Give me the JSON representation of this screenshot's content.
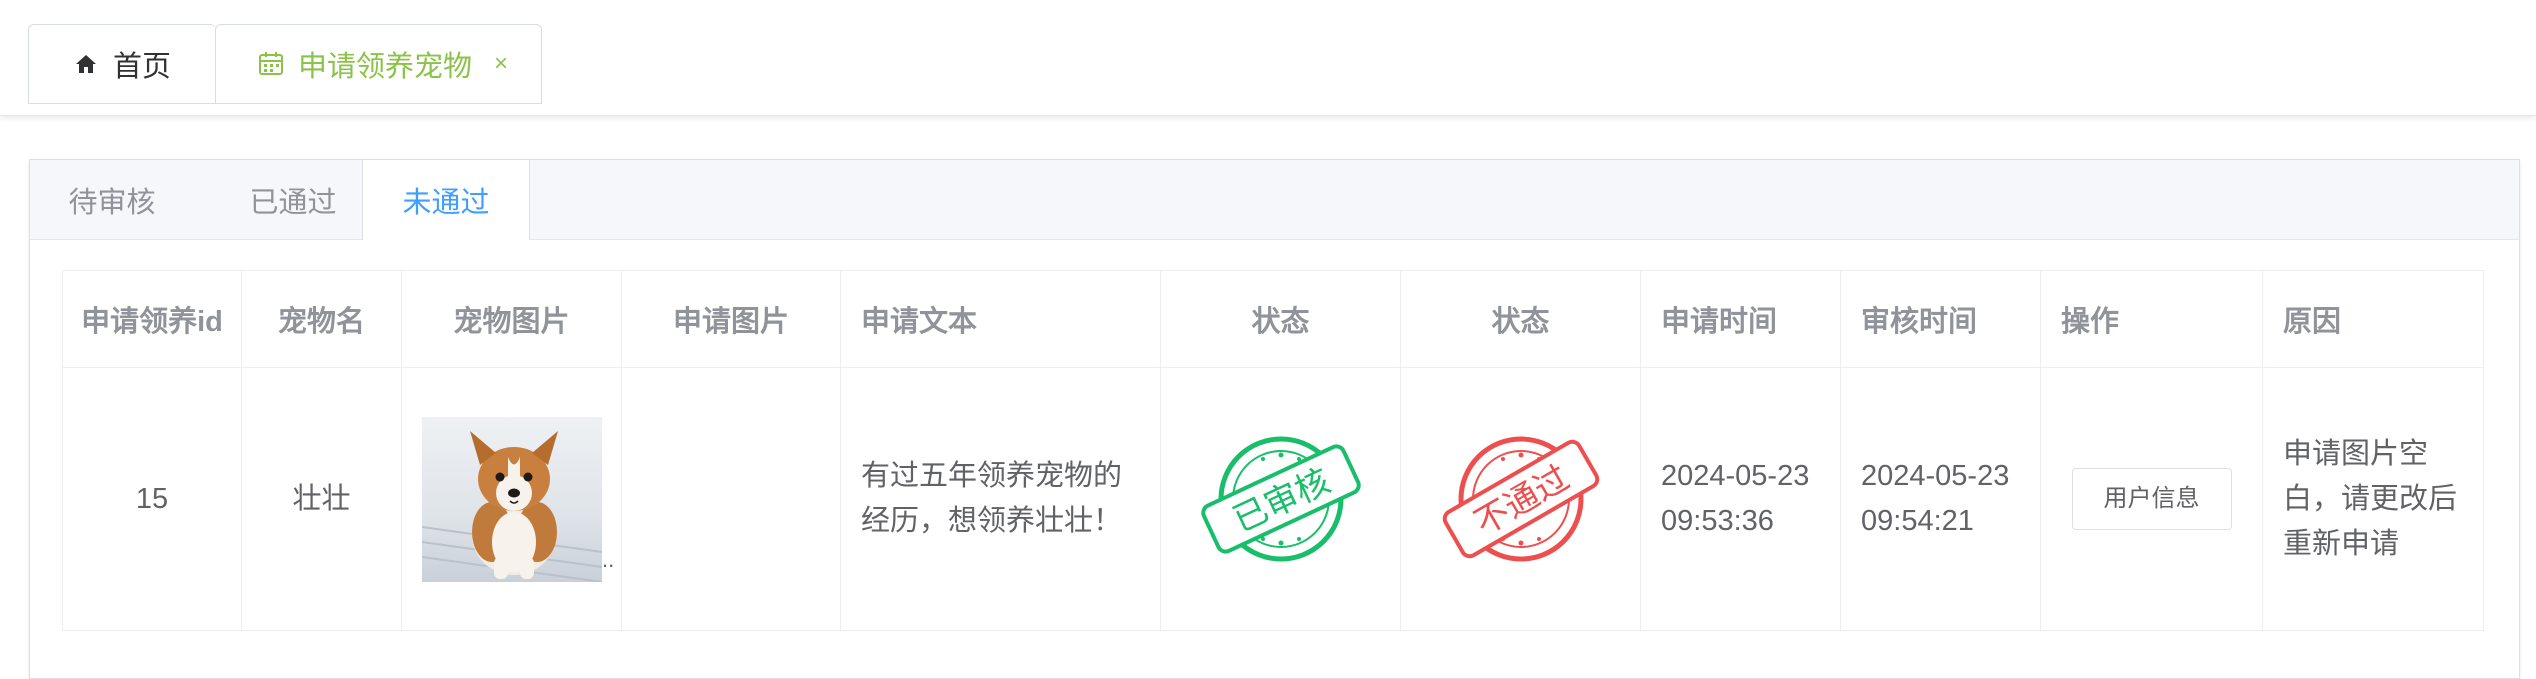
{
  "tags": {
    "home": {
      "label": "首页",
      "icon": "home-icon"
    },
    "active": {
      "label": "申请领养宠物",
      "icon": "calendar-icon",
      "close": "×"
    }
  },
  "tabs": [
    {
      "label": "待审核",
      "active": false
    },
    {
      "label": "已通过",
      "active": false
    },
    {
      "label": "未通过",
      "active": true
    }
  ],
  "table": {
    "headers": [
      "申请领养id",
      "宠物名",
      "宠物图片",
      "申请图片",
      "申请文本",
      "状态",
      "状态",
      "申请时间",
      "审核时间",
      "操作",
      "原因"
    ],
    "rows": [
      {
        "id": "15",
        "pet_name": "壮壮",
        "pet_image": "puppy-photo",
        "pet_image_ellipsis": "..",
        "apply_image": "",
        "apply_text": "有过五年领养宠物的经历，想领养壮壮！",
        "status1_stamp": "已审核",
        "status2_stamp": "不通过",
        "apply_time": "2024-05-23 09:53:36",
        "review_time": "2024-05-23 09:54:21",
        "action_label": "用户信息",
        "reason": "申请图片空白，请更改后重新申请"
      }
    ]
  },
  "colors": {
    "accent_green": "#8bc34a",
    "tab_active": "#409eff",
    "stamp_green": "#19be6b",
    "stamp_red": "#ed4f4f"
  }
}
